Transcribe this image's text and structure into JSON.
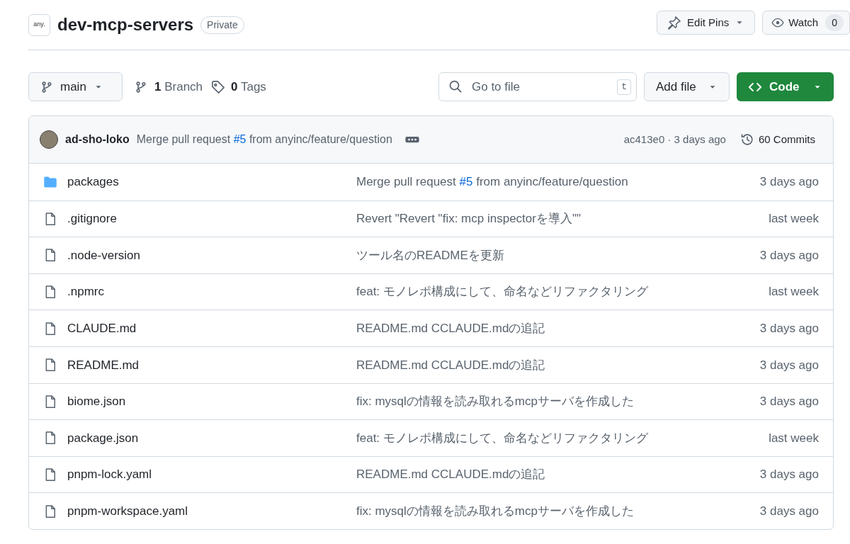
{
  "repo": {
    "logo": "any.",
    "name": "dev-mcp-servers",
    "visibility": "Private"
  },
  "header_actions": {
    "edit_pins": "Edit Pins",
    "watch": "Watch",
    "watch_count": "0"
  },
  "toolbar": {
    "branch": "main",
    "branch_count": "1",
    "branch_label": "Branch",
    "tag_count": "0",
    "tag_label": "Tags",
    "search": {
      "placeholder": "Go to file",
      "shortcut": "t"
    },
    "add_file": "Add file",
    "code": "Code"
  },
  "latest_commit": {
    "author": "ad-sho-loko",
    "message": [
      {
        "kind": "text",
        "text": "Merge pull request "
      },
      {
        "kind": "link",
        "text": "#5"
      },
      {
        "kind": "text",
        "text": " from anyinc/feature/question"
      }
    ],
    "hash_time": "ac413e0 · 3 days ago",
    "commits": "60 Commits"
  },
  "files": [
    {
      "kind": "folder",
      "name": "packages",
      "message": [
        {
          "kind": "text",
          "text": "Merge pull request "
        },
        {
          "kind": "link",
          "text": "#5"
        },
        {
          "kind": "text",
          "text": " from anyinc/feature/question"
        }
      ],
      "time": "3 days ago"
    },
    {
      "kind": "file",
      "name": ".gitignore",
      "message": [
        {
          "kind": "text",
          "text": "Revert \"Revert \"fix: mcp inspectorを導入\"\""
        }
      ],
      "time": "last week"
    },
    {
      "kind": "file",
      "name": ".node-version",
      "message": [
        {
          "kind": "text",
          "text": "ツール名のREADMEを更新"
        }
      ],
      "time": "3 days ago"
    },
    {
      "kind": "file",
      "name": ".npmrc",
      "message": [
        {
          "kind": "text",
          "text": "feat: モノレポ構成にして、命名などリファクタリング"
        }
      ],
      "time": "last week"
    },
    {
      "kind": "file",
      "name": "CLAUDE.md",
      "message": [
        {
          "kind": "text",
          "text": "README.md CCLAUDE.mdの追記"
        }
      ],
      "time": "3 days ago"
    },
    {
      "kind": "file",
      "name": "README.md",
      "message": [
        {
          "kind": "text",
          "text": "README.md CCLAUDE.mdの追記"
        }
      ],
      "time": "3 days ago"
    },
    {
      "kind": "file",
      "name": "biome.json",
      "message": [
        {
          "kind": "text",
          "text": "fix: mysqlの情報を読み取れるmcpサーバを作成した"
        }
      ],
      "time": "3 days ago"
    },
    {
      "kind": "file",
      "name": "package.json",
      "message": [
        {
          "kind": "text",
          "text": "feat: モノレポ構成にして、命名などリファクタリング"
        }
      ],
      "time": "last week"
    },
    {
      "kind": "file",
      "name": "pnpm-lock.yaml",
      "message": [
        {
          "kind": "text",
          "text": "README.md CCLAUDE.mdの追記"
        }
      ],
      "time": "3 days ago"
    },
    {
      "kind": "file",
      "name": "pnpm-workspace.yaml",
      "message": [
        {
          "kind": "text",
          "text": "fix: mysqlの情報を読み取れるmcpサーバを作成した"
        }
      ],
      "time": "3 days ago"
    }
  ]
}
